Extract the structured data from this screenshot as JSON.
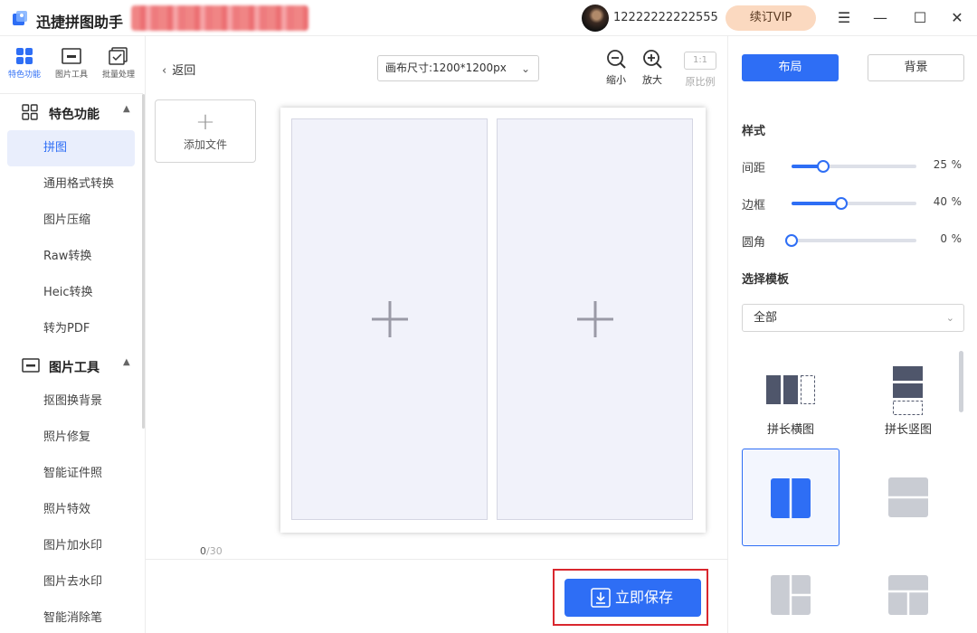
{
  "app": {
    "name": "迅捷拼图助手",
    "logo_icon": "app-logo-icon"
  },
  "user": {
    "account": "12222222222555",
    "vip_label": "续订VIP"
  },
  "window_controls": {
    "menu": "☰",
    "minimize": "—",
    "maximize": "☐",
    "close": "✕"
  },
  "rail": [
    {
      "label": "特色功能",
      "icon": "grid-apps-icon",
      "active": true
    },
    {
      "label": "图片工具",
      "icon": "image-tool-icon",
      "active": false
    },
    {
      "label": "批量处理",
      "icon": "batch-icon",
      "active": false
    }
  ],
  "sidebar": {
    "groups": [
      {
        "label": "特色功能",
        "icon": "grid-apps-icon",
        "caret": "▲",
        "items": [
          "拼图",
          "通用格式转换",
          "图片压缩",
          "Raw转换",
          "Heic转换",
          "转为PDF"
        ]
      },
      {
        "label": "图片工具",
        "icon": "image-tool-icon",
        "caret": "▲",
        "items": [
          "抠图换背景",
          "照片修复",
          "智能证件照",
          "照片特效",
          "图片加水印",
          "图片去水印",
          "智能消除笔"
        ]
      }
    ],
    "active_item": "拼图"
  },
  "toolbar": {
    "back_label": "返回",
    "canvas_size": "画布尺寸:1200*1200px",
    "zoom_out_label": "缩小",
    "zoom_in_label": "放大",
    "ratio_box": "1:1",
    "ratio_label": "原比例"
  },
  "files": {
    "add_label": "添加文件",
    "count": "0",
    "total": "/30"
  },
  "canvas": {
    "cells": 2
  },
  "save": {
    "label": "立即保存"
  },
  "right_panel": {
    "tabs": {
      "layout": "布局",
      "background": "背景"
    },
    "style_title": "样式",
    "sliders": [
      {
        "label": "间距",
        "value": "25",
        "unit": "%",
        "fraction": 0.25
      },
      {
        "label": "边框",
        "value": "40",
        "unit": "%",
        "fraction": 0.4
      },
      {
        "label": "圆角",
        "value": "0",
        "unit": "%",
        "fraction": 0.0
      }
    ],
    "template_title": "选择模板",
    "template_filter": "全部",
    "templates": [
      {
        "label": "拼长横图"
      },
      {
        "label": "拼长竖图"
      }
    ]
  },
  "colors": {
    "accent": "#2e6ef5",
    "vip_bg": "#fbd9c0",
    "highlight_border": "#d9272e"
  }
}
